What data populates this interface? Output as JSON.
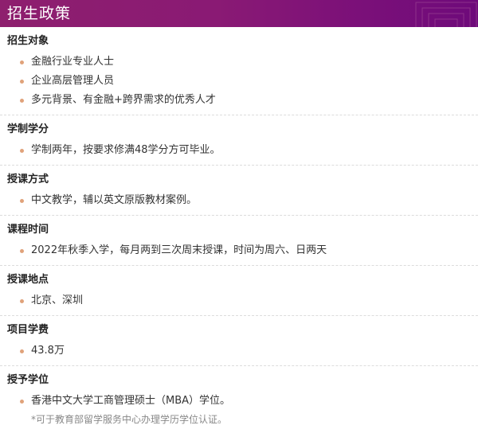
{
  "header": {
    "title": "招生政策"
  },
  "colors": {
    "header_bg": "#8a1a74",
    "bullet": "#e0a27a",
    "note_text": "#888888"
  },
  "sections": [
    {
      "title": "招生对象",
      "items": [
        "金融行业专业人士",
        "企业高层管理人员",
        "多元背景、有金融+跨界需求的优秀人才"
      ]
    },
    {
      "title": "学制学分",
      "items": [
        "学制两年，按要求修满48学分方可毕业。"
      ]
    },
    {
      "title": "授课方式",
      "items": [
        "中文教学，辅以英文原版教材案例。"
      ]
    },
    {
      "title": "课程时间",
      "items": [
        "2022年秋季入学，每月两到三次周末授课，时间为周六、日两天"
      ]
    },
    {
      "title": "授课地点",
      "items": [
        "北京、深圳"
      ]
    },
    {
      "title": "项目学费",
      "items": [
        "43.8万"
      ]
    },
    {
      "title": "授予学位",
      "items": [
        "香港中文大学工商管理硕士（MBA）学位。"
      ],
      "note": "*可于教育部留学服务中心办理学历学位认证。"
    }
  ]
}
